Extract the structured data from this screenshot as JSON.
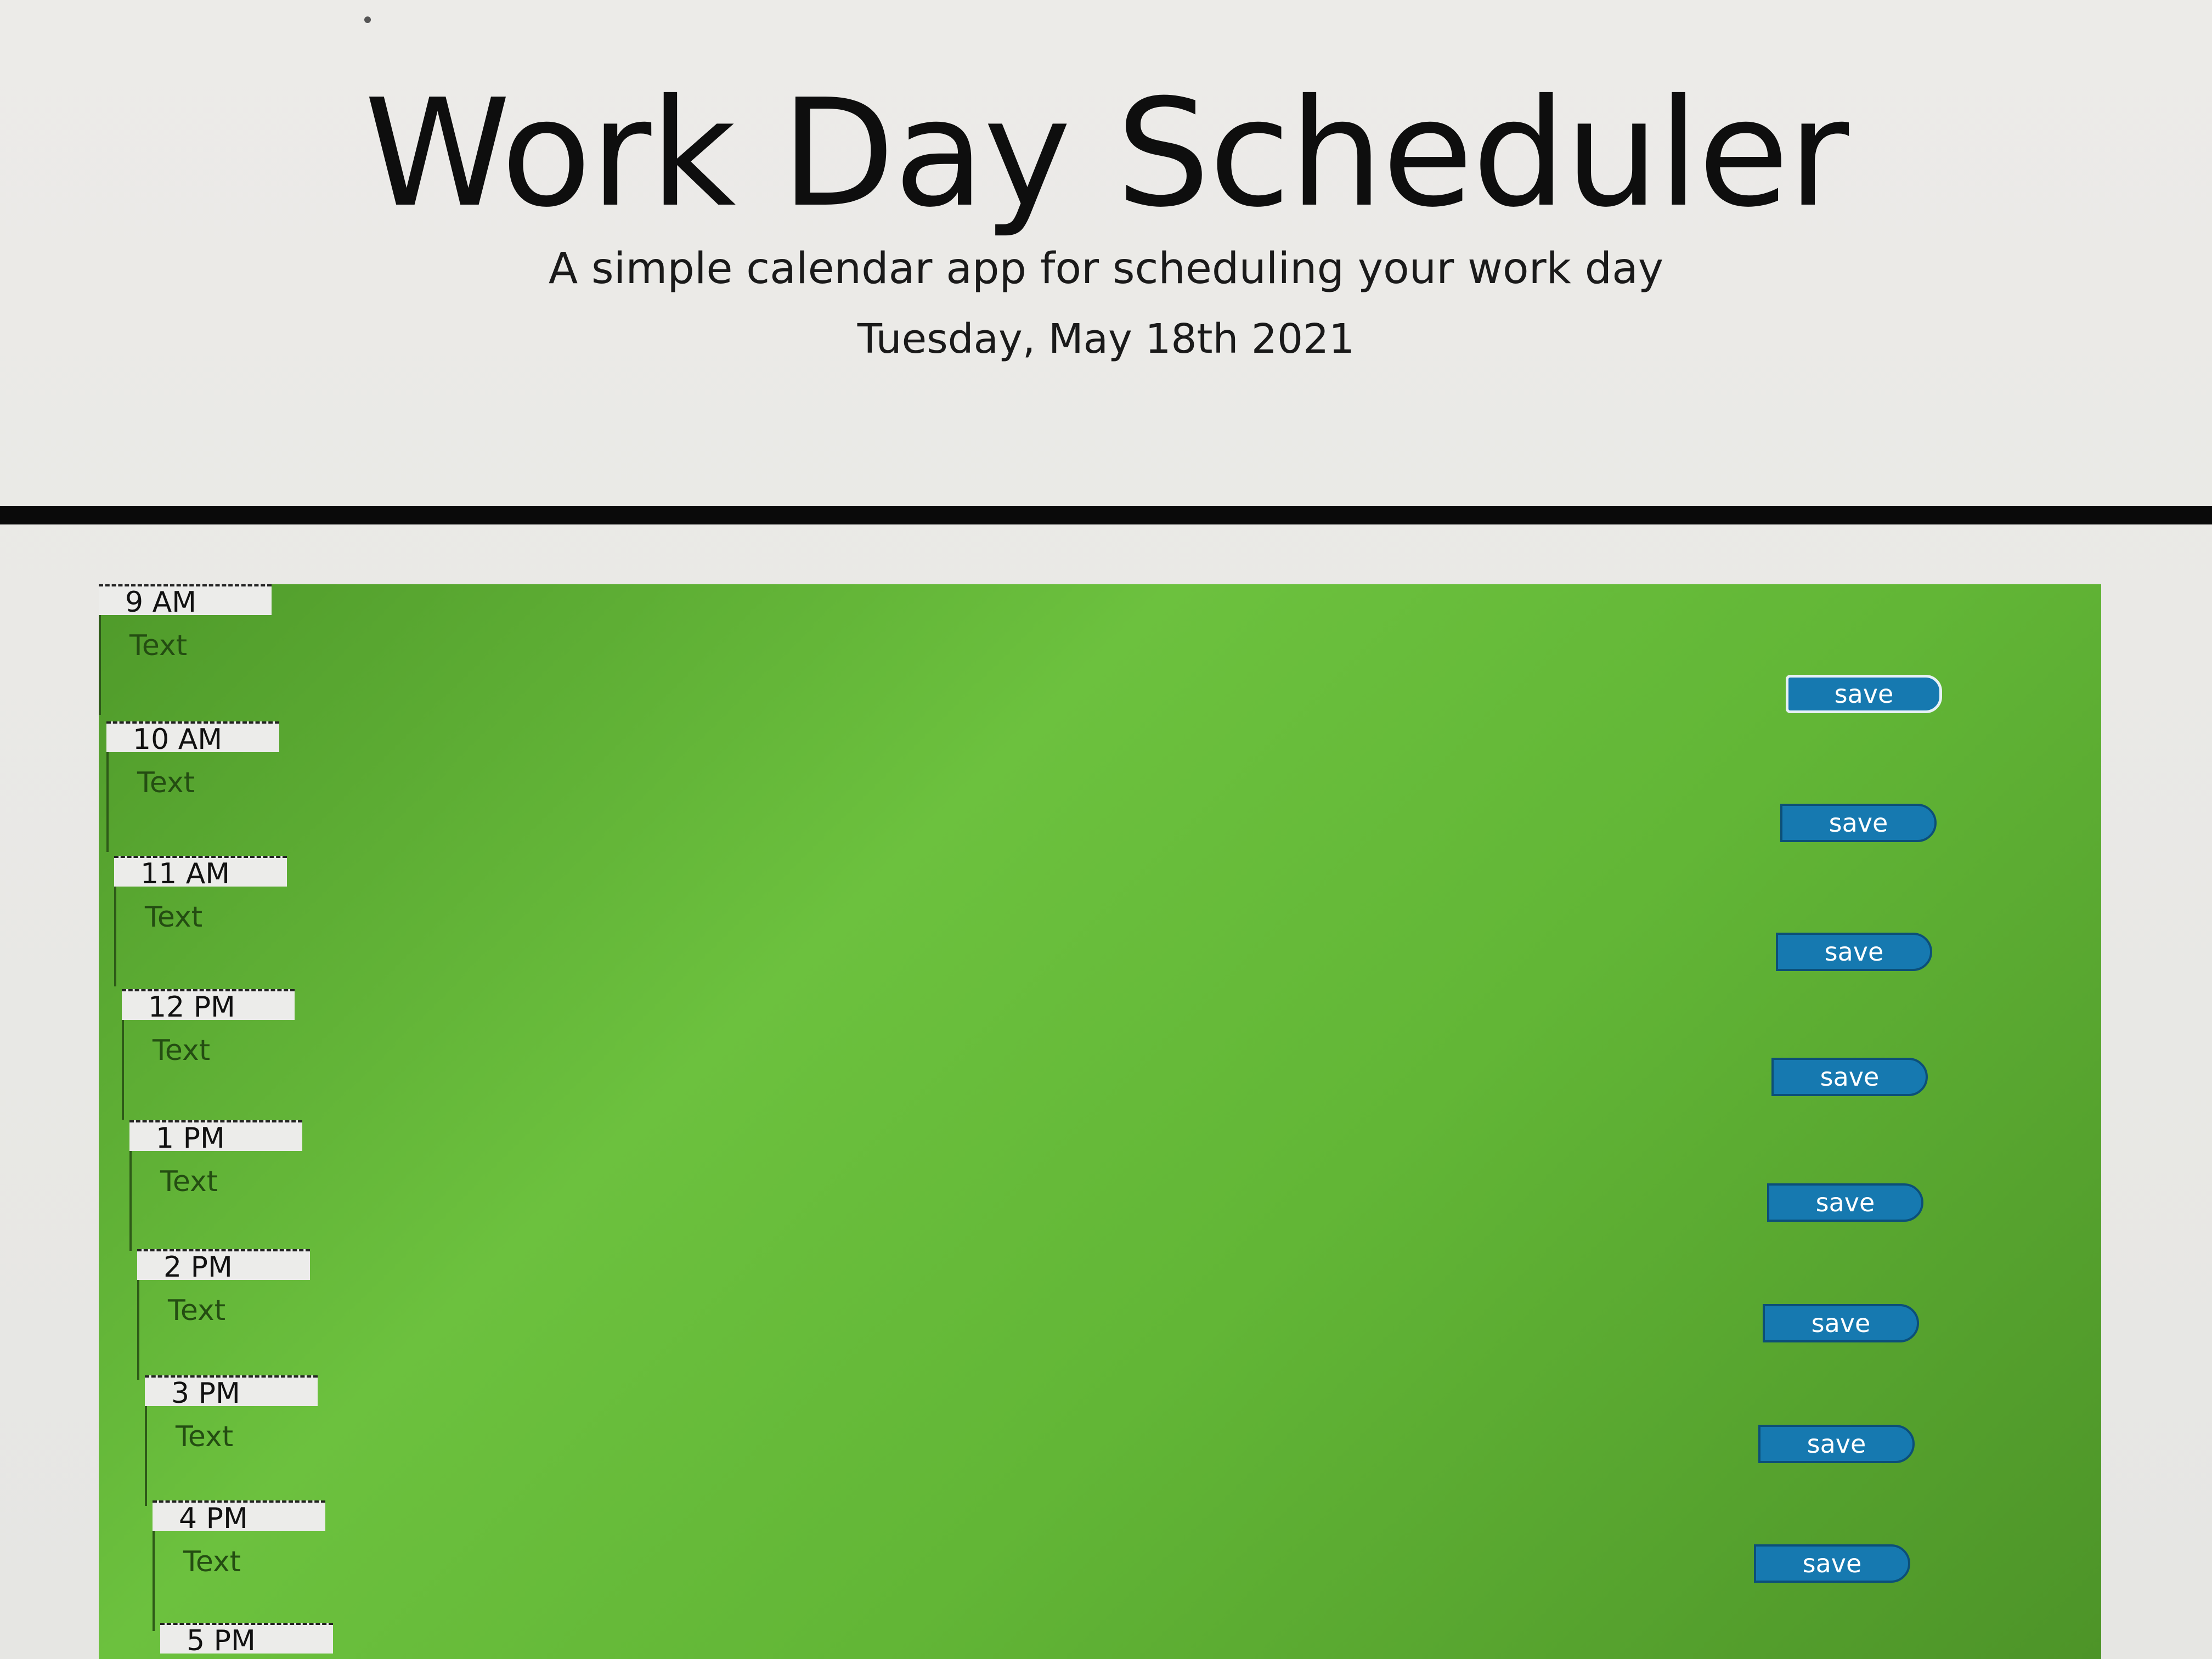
{
  "header": {
    "title": "Work Day Scheduler",
    "subtitle": "A simple calendar app for scheduling your work day",
    "current_day": "Tuesday, May 18th 2021"
  },
  "colors": {
    "planner_green": "#62b636",
    "save_blue": "#1679b0",
    "divider_black": "#0a0a0a"
  },
  "hours": [
    {
      "label": "9 AM",
      "text": "Text",
      "save_label": "save"
    },
    {
      "label": "10 AM",
      "text": "Text",
      "save_label": "save"
    },
    {
      "label": "11 AM",
      "text": "Text",
      "save_label": "save"
    },
    {
      "label": "12 PM",
      "text": "Text",
      "save_label": "save"
    },
    {
      "label": "1 PM",
      "text": "Text",
      "save_label": "save"
    },
    {
      "label": "2 PM",
      "text": "Text",
      "save_label": "save"
    },
    {
      "label": "3 PM",
      "text": "Text",
      "save_label": "save"
    },
    {
      "label": "4 PM",
      "text": "Text",
      "save_label": "save"
    },
    {
      "label": "5 PM",
      "text": "",
      "save_label": ""
    }
  ]
}
